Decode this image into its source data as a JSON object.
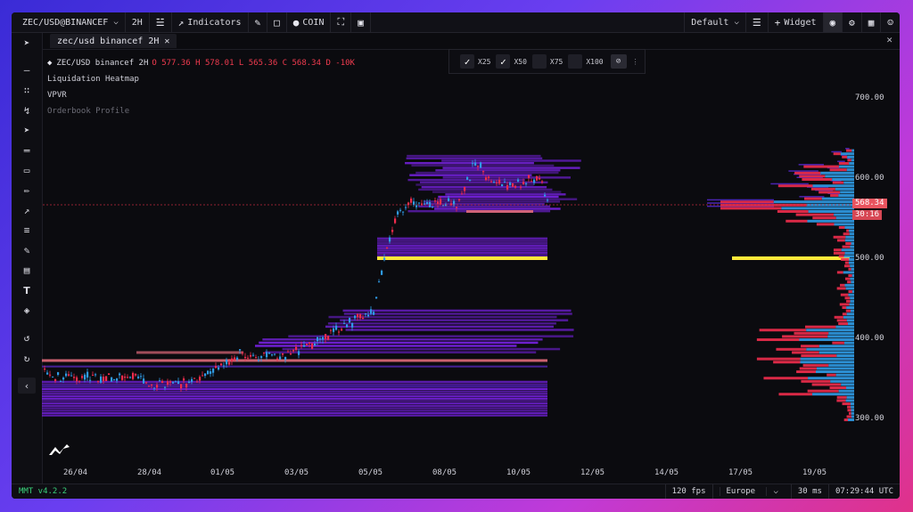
{
  "topbar": {
    "symbol": "ZEC/USD@BINANCEF",
    "timeframe": "2H",
    "indicators_label": "Indicators",
    "coin_label": "COIN",
    "layout_label": "Default",
    "widget_label": "Widget"
  },
  "tab": {
    "label": "zec/usd binancef 2H"
  },
  "legend": {
    "title": "ZEC/USD binancef 2H",
    "ohlc": "O 577.36 H 578.01 L 565.36 C 568.34 D -10K",
    "rows": [
      "Liquidation Heatmap",
      "VPVR",
      "Orderbook Profile"
    ]
  },
  "leverage": {
    "items": [
      {
        "label": "X25",
        "checked": true
      },
      {
        "label": "X50",
        "checked": true
      },
      {
        "label": "X75",
        "checked": false
      },
      {
        "label": "X100",
        "checked": false
      }
    ]
  },
  "yaxis": {
    "labels": [
      "700.00",
      "600.00",
      "500.00",
      "400.00",
      "300.00"
    ]
  },
  "price_tag": {
    "value": "568.34",
    "countdown": "30:16"
  },
  "xaxis": {
    "labels": [
      "26/04",
      "28/04",
      "01/05",
      "03/05",
      "05/05",
      "08/05",
      "10/05",
      "12/05",
      "14/05",
      "17/05",
      "19/05"
    ]
  },
  "status": {
    "version": "MMT v4.2.2",
    "fps": "120 fps",
    "region": "Europe",
    "latency": "30 ms",
    "clock": "07:29:44 UTC"
  },
  "colors": {
    "bull": "#2f9be6",
    "bear": "#f02c4c",
    "heat": "#7a22e8",
    "highlight": "#ffe93a"
  },
  "icons": [
    "cursor-icon",
    "line-icon",
    "nodes-icon",
    "path-icon",
    "arrow-icon",
    "parallel-icon",
    "rect-icon",
    "brush-icon",
    "chart-icon",
    "fib-icon",
    "ruler-icon",
    "volume-icon",
    "text-icon",
    "layers-icon",
    "undo-icon",
    "redo-icon",
    "collapse-icon"
  ]
}
